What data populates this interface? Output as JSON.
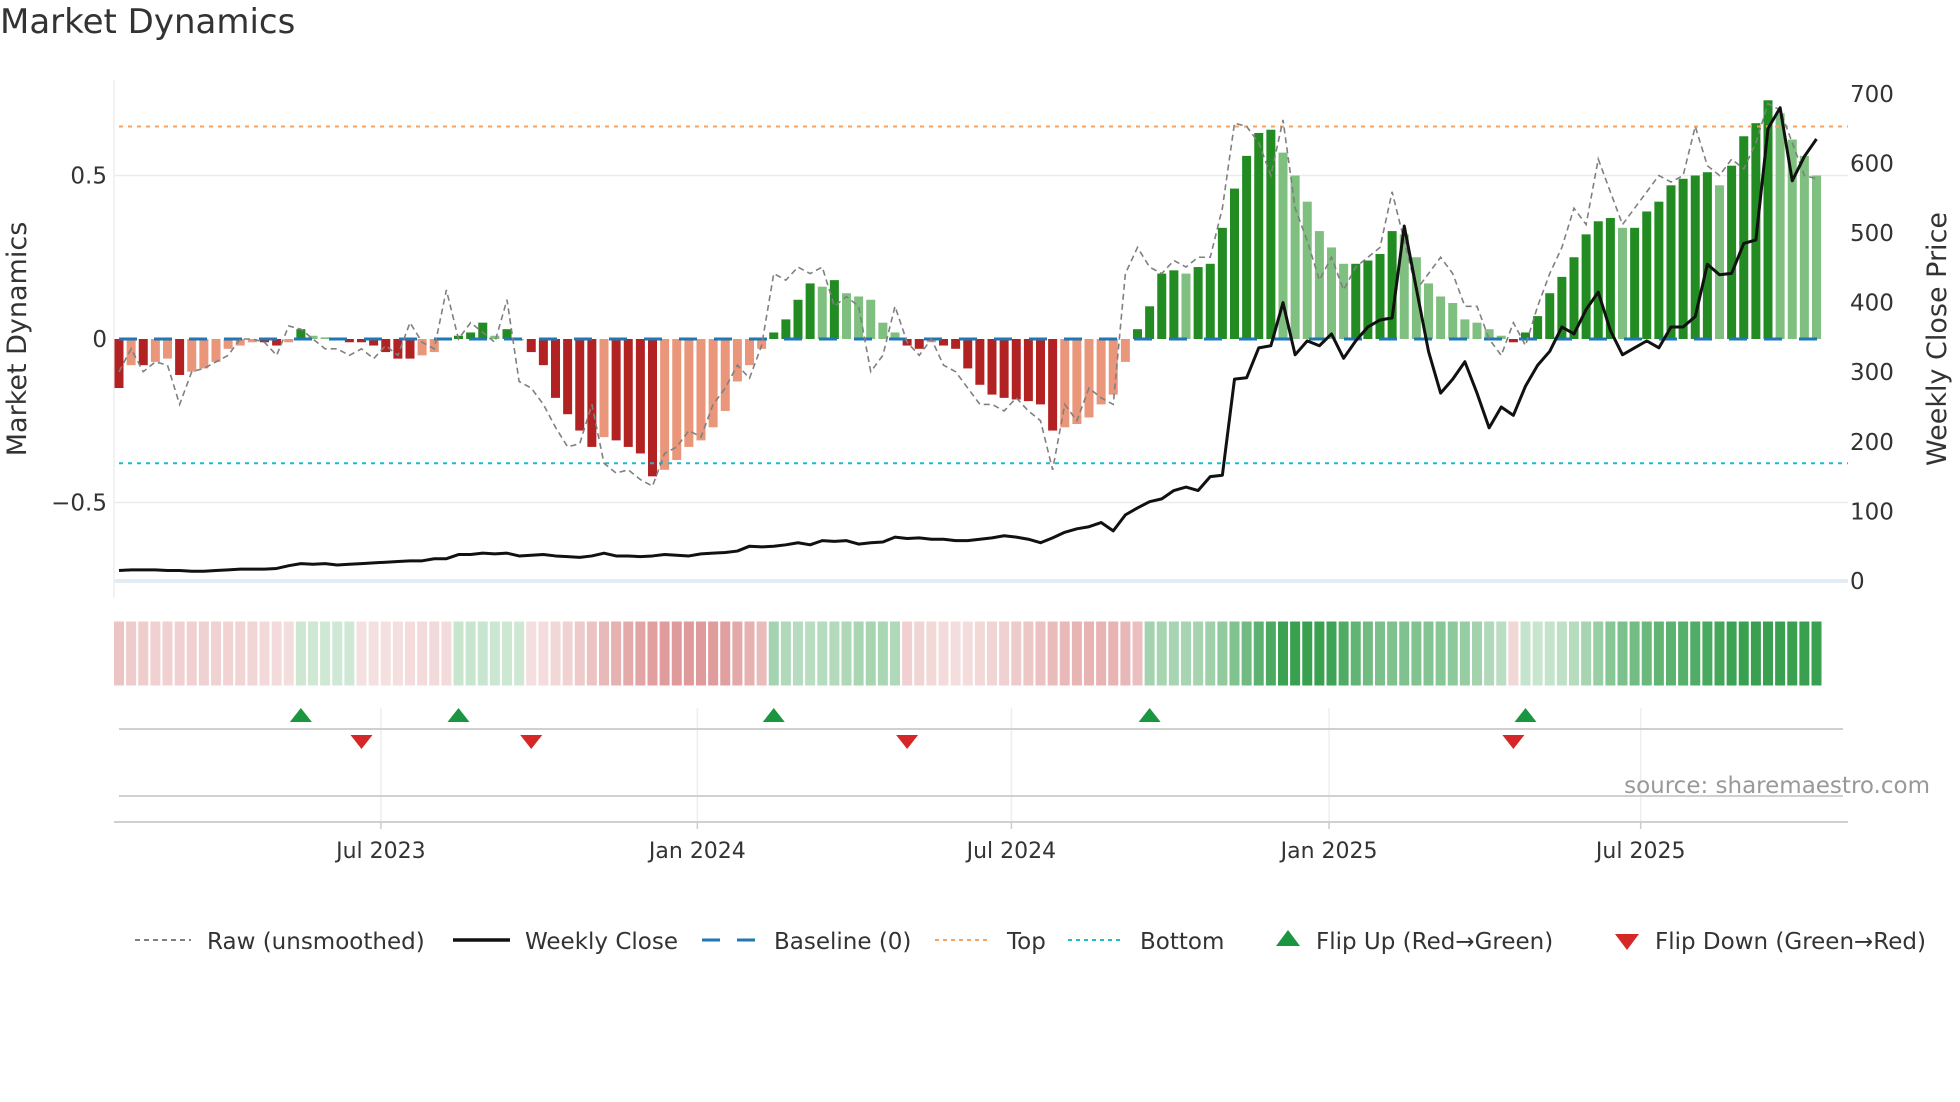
{
  "title": "Market Dynamics",
  "chart_data": {
    "type": "bar",
    "title": "Market Dynamics",
    "ylabel": "Market Dynamics",
    "ylabel_right": "Weekly Close Price",
    "ylim": [
      -0.75,
      0.78
    ],
    "ylim_right": [
      0,
      720
    ],
    "yticks": [
      {
        "v": 0.5,
        "label": "0.5"
      },
      {
        "v": 0,
        "label": "0"
      },
      {
        "v": -0.5,
        "label": "−0.5"
      }
    ],
    "yticks_right": [
      {
        "v": 0,
        "label": "0"
      },
      {
        "v": 100,
        "label": "100"
      },
      {
        "v": 200,
        "label": "200"
      },
      {
        "v": 300,
        "label": "300"
      },
      {
        "v": 400,
        "label": "400"
      },
      {
        "v": 500,
        "label": "500"
      },
      {
        "v": 600,
        "label": "600"
      },
      {
        "v": 700,
        "label": "700"
      }
    ],
    "xticks": [
      {
        "week": 21.6,
        "label": "Jul 2023"
      },
      {
        "week": 47.7,
        "label": "Jan 2024"
      },
      {
        "week": 73.6,
        "label": "Jul 2024"
      },
      {
        "week": 99.8,
        "label": "Jan 2025"
      },
      {
        "week": 125.5,
        "label": "Jul 2025"
      }
    ],
    "top": 0.65,
    "bottom": -0.38,
    "baseline": 0,
    "smoothed": [
      -0.15,
      -0.08,
      -0.08,
      -0.07,
      -0.06,
      -0.11,
      -0.1,
      -0.09,
      -0.07,
      -0.03,
      -0.02,
      -0.01,
      -0.01,
      -0.02,
      -0.01,
      0.03,
      0.01,
      0.005,
      0,
      -0.01,
      -0.01,
      -0.02,
      -0.04,
      -0.06,
      -0.06,
      -0.05,
      -0.04,
      0,
      0.01,
      0.02,
      0.05,
      0.01,
      0.03,
      0,
      -0.04,
      -0.08,
      -0.18,
      -0.23,
      -0.28,
      -0.33,
      -0.3,
      -0.31,
      -0.33,
      -0.35,
      -0.42,
      -0.4,
      -0.37,
      -0.33,
      -0.31,
      -0.27,
      -0.22,
      -0.13,
      -0.08,
      -0.03,
      0.02,
      0.06,
      0.12,
      0.17,
      0.16,
      0.18,
      0.14,
      0.13,
      0.12,
      0.05,
      0.02,
      -0.02,
      -0.03,
      -0.01,
      -0.02,
      -0.03,
      -0.09,
      -0.14,
      -0.17,
      -0.18,
      -0.185,
      -0.19,
      -0.2,
      -0.28,
      -0.27,
      -0.26,
      -0.24,
      -0.2,
      -0.17,
      -0.07,
      0.03,
      0.1,
      0.2,
      0.21,
      0.2,
      0.22,
      0.23,
      0.34,
      0.46,
      0.56,
      0.63,
      0.64,
      0.57,
      0.5,
      0.42,
      0.33,
      0.28,
      0.23,
      0.23,
      0.24,
      0.26,
      0.33,
      0.32,
      0.25,
      0.17,
      0.13,
      0.11,
      0.06,
      0.05,
      0.03,
      0.01,
      -0.01,
      0.02,
      0.07,
      0.14,
      0.19,
      0.25,
      0.32,
      0.36,
      0.37,
      0.34,
      0.34,
      0.39,
      0.42,
      0.47,
      0.49,
      0.5,
      0.51,
      0.47,
      0.53,
      0.62,
      0.66,
      0.73,
      0.69,
      0.61,
      0.56,
      0.5
    ],
    "raw": [
      -0.1,
      -0.03,
      -0.1,
      -0.07,
      -0.08,
      -0.2,
      -0.1,
      -0.09,
      -0.07,
      -0.05,
      0,
      0,
      -0.01,
      -0.05,
      0.04,
      0.03,
      0,
      -0.03,
      -0.03,
      -0.05,
      -0.03,
      -0.06,
      -0.02,
      -0.05,
      0.05,
      -0.01,
      -0.03,
      0.15,
      0,
      0.05,
      0.02,
      -0.01,
      0.12,
      -0.13,
      -0.15,
      -0.2,
      -0.27,
      -0.33,
      -0.32,
      -0.2,
      -0.38,
      -0.41,
      -0.4,
      -0.43,
      -0.45,
      -0.35,
      -0.33,
      -0.28,
      -0.3,
      -0.2,
      -0.15,
      -0.08,
      -0.12,
      -0.02,
      0.2,
      0.18,
      0.22,
      0.2,
      0.22,
      0.1,
      0.13,
      0.1,
      -0.1,
      -0.05,
      0.1,
      -0.01,
      -0.05,
      0,
      -0.08,
      -0.1,
      -0.15,
      -0.2,
      -0.2,
      -0.22,
      -0.18,
      -0.22,
      -0.25,
      -0.4,
      -0.2,
      -0.25,
      -0.15,
      -0.18,
      -0.2,
      0.2,
      0.28,
      0.22,
      0.2,
      0.24,
      0.22,
      0.25,
      0.25,
      0.4,
      0.66,
      0.65,
      0.6,
      0.5,
      0.67,
      0.4,
      0.3,
      0.18,
      0.25,
      0.15,
      0.22,
      0.25,
      0.28,
      0.45,
      0.3,
      0.15,
      0.2,
      0.25,
      0.2,
      0.1,
      0.1,
      0,
      -0.05,
      0.05,
      -0.02,
      0.1,
      0.2,
      0.28,
      0.4,
      0.35,
      0.55,
      0.45,
      0.35,
      0.4,
      0.45,
      0.5,
      0.48,
      0.5,
      0.65,
      0.53,
      0.5,
      0.55,
      0.52,
      0.6,
      0.72,
      0.7,
      0.6,
      0.5,
      0.49
    ],
    "weekly_close": [
      15,
      16,
      16,
      16,
      15,
      15,
      14,
      14,
      15,
      16,
      17,
      17,
      17,
      18,
      22,
      25,
      24,
      25,
      23,
      24,
      25,
      26,
      27,
      28,
      29,
      29,
      32,
      32,
      38,
      38,
      40,
      39,
      40,
      36,
      37,
      38,
      36,
      35,
      34,
      36,
      40,
      36,
      36,
      35,
      36,
      38,
      37,
      36,
      39,
      40,
      41,
      43,
      50,
      49,
      50,
      52,
      55,
      52,
      58,
      57,
      58,
      53,
      55,
      56,
      63,
      61,
      62,
      60,
      60,
      58,
      58,
      60,
      62,
      65,
      63,
      60,
      55,
      62,
      70,
      75,
      78,
      84,
      72,
      95,
      105,
      114,
      118,
      130,
      135,
      130,
      150,
      152,
      290,
      292,
      335,
      338,
      400,
      325,
      345,
      338,
      355,
      320,
      345,
      365,
      375,
      378,
      510,
      420,
      330,
      270,
      290,
      315,
      270,
      220,
      250,
      238,
      280,
      310,
      330,
      365,
      355,
      390,
      415,
      360,
      325,
      335,
      345,
      335,
      365,
      365,
      380,
      455,
      440,
      442,
      485,
      490,
      650,
      680,
      575,
      610,
      635
    ],
    "flips": [
      {
        "week": 15,
        "dir": "up"
      },
      {
        "week": 20,
        "dir": "down"
      },
      {
        "week": 28,
        "dir": "up"
      },
      {
        "week": 34,
        "dir": "down"
      },
      {
        "week": 54,
        "dir": "up"
      },
      {
        "week": 65,
        "dir": "down"
      },
      {
        "week": 85,
        "dir": "up"
      },
      {
        "week": 115,
        "dir": "down"
      },
      {
        "week": 116,
        "dir": "up"
      }
    ],
    "colors": {
      "pos_rising": "#228b22",
      "pos_falling": "#7fbf7f",
      "neg_falling": "#b22222",
      "neg_rising": "#e9967a",
      "top": "#f4a460",
      "bottom": "#17becf",
      "baseline": "#1f77b4",
      "flip_up": "#1a9641",
      "flip_down": "#d62728",
      "close": "#111111",
      "raw": "#808080"
    },
    "legend": [
      {
        "key": "raw",
        "label": "Raw (unsmoothed)"
      },
      {
        "key": "close",
        "label": "Weekly Close"
      },
      {
        "key": "baseline",
        "label": "Baseline (0)"
      },
      {
        "key": "top",
        "label": "Top"
      },
      {
        "key": "bottom",
        "label": "Bottom"
      },
      {
        "key": "flip_up",
        "label": "Flip Up (Red→Green)"
      },
      {
        "key": "flip_down",
        "label": "Flip Down (Green→Red)"
      }
    ],
    "legend_placement": "bottom"
  },
  "source": "source: sharemaestro.com"
}
